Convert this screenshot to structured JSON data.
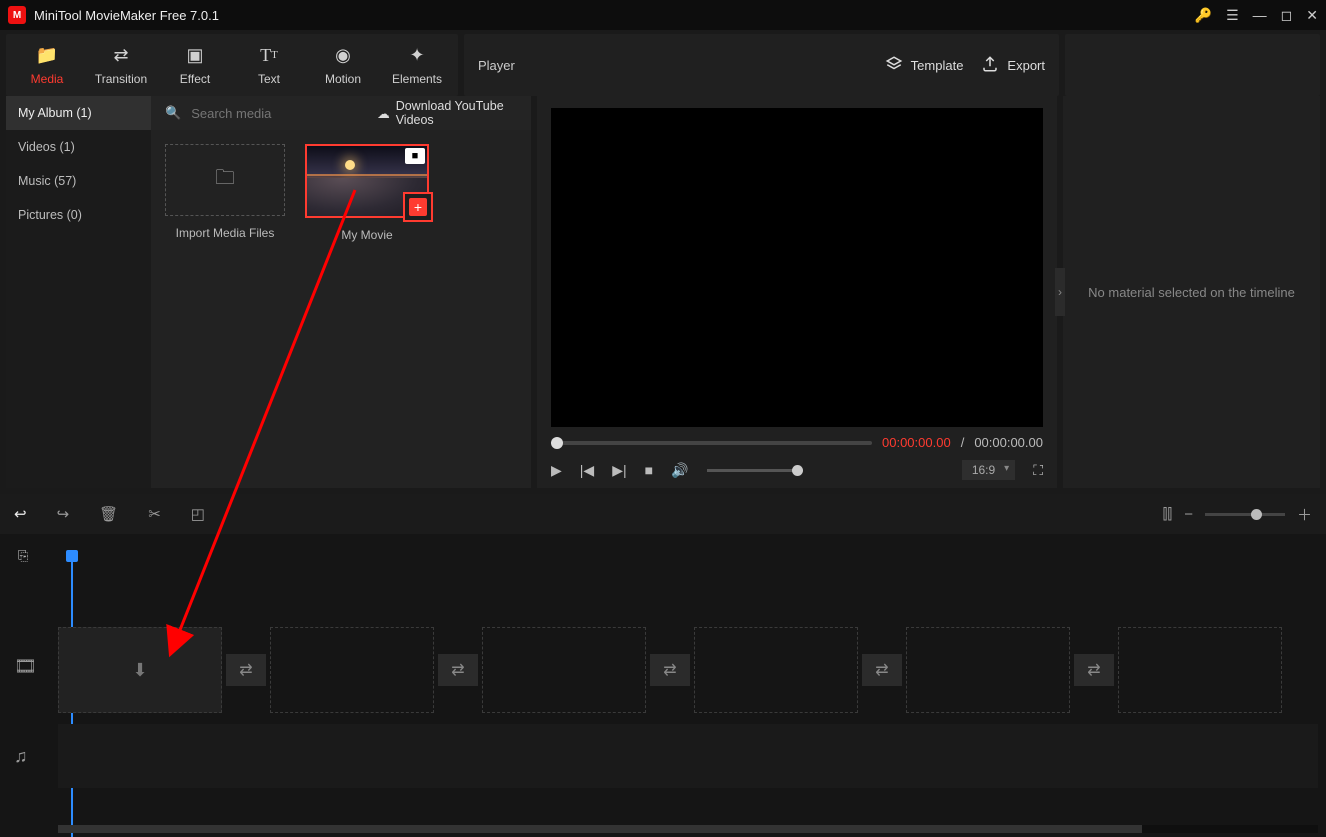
{
  "app": {
    "title": "MiniTool MovieMaker Free 7.0.1"
  },
  "tabs": [
    {
      "id": "media",
      "label": "Media"
    },
    {
      "id": "transition",
      "label": "Transition"
    },
    {
      "id": "effect",
      "label": "Effect"
    },
    {
      "id": "text",
      "label": "Text"
    },
    {
      "id": "motion",
      "label": "Motion"
    },
    {
      "id": "elements",
      "label": "Elements"
    }
  ],
  "player_header": {
    "title": "Player",
    "template": "Template",
    "export": "Export"
  },
  "media_sidebar": {
    "items": [
      {
        "label": "My Album (1)"
      },
      {
        "label": "Videos (1)"
      },
      {
        "label": "Music (57)"
      },
      {
        "label": "Pictures (0)"
      }
    ]
  },
  "search": {
    "placeholder": "Search media"
  },
  "download_yt": "Download YouTube Videos",
  "media_items": {
    "import_label": "Import Media Files",
    "clip1_label": "My Movie"
  },
  "player": {
    "current": "00:00:00.00",
    "sep": " / ",
    "total": "00:00:00.00",
    "aspect": "16:9"
  },
  "inspector": {
    "empty": "No material selected on the timeline"
  }
}
